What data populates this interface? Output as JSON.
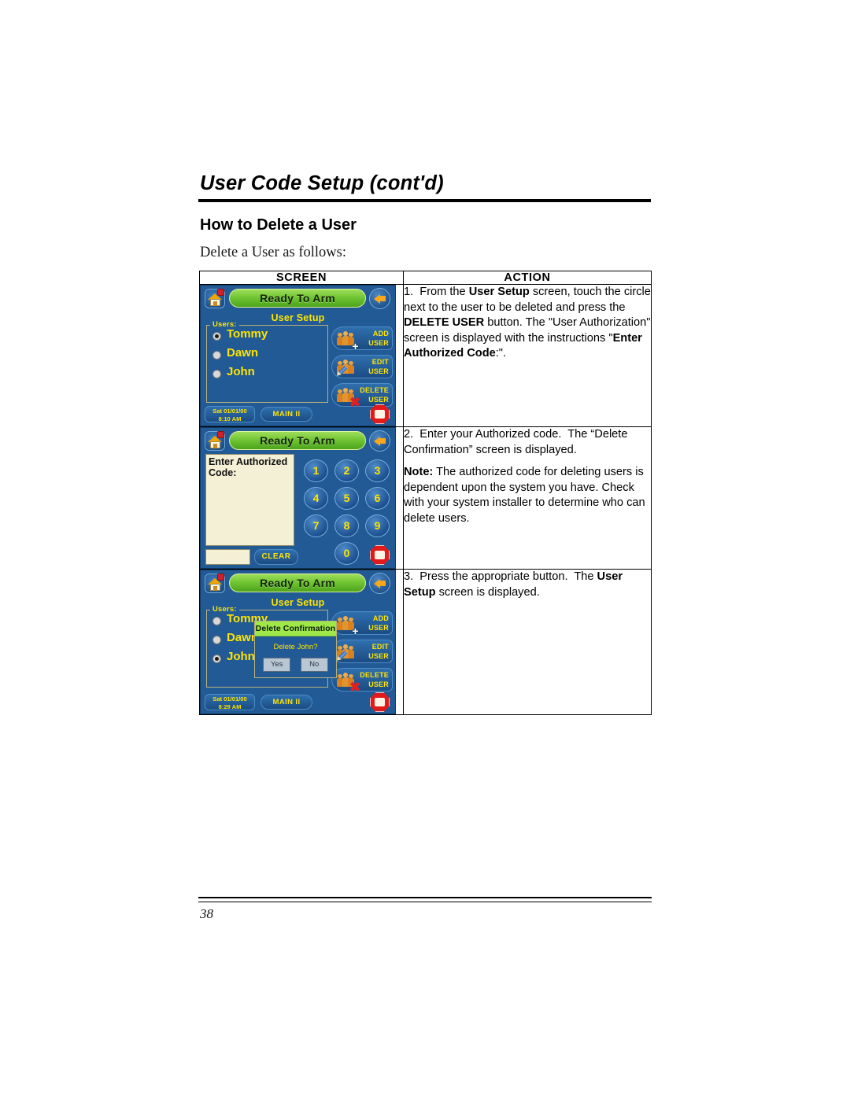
{
  "document": {
    "chapter_title": "User Code Setup (cont'd)",
    "section_heading": "How to Delete a User",
    "intro": "Delete a User as follows:",
    "page_number": "38"
  },
  "table": {
    "headers": {
      "screen": "SCREEN",
      "action": "ACTION"
    },
    "rows": [
      {
        "action_paragraphs": [
          "1.  From the User Setup screen, touch the circle next to the user to be deleted and press the DELETE USER button. The \"User Authorization\" screen is displayed with the instructions \"Enter Authorized Code:\"."
        ]
      },
      {
        "action_paragraphs": [
          "2.  Enter your Authorized code.  The “Delete Confirmation” screen is displayed.",
          "Note: The authorized code for deleting users is dependent upon the system you have. Check with your system installer to determine who can delete users."
        ]
      },
      {
        "action_paragraphs": [
          "3.  Press the appropriate button.  The User Setup screen is displayed."
        ]
      }
    ]
  },
  "panel1": {
    "status": "Ready To Arm",
    "screen_title": "User Setup",
    "users_legend": "Users:",
    "users": [
      {
        "name": "Tommy",
        "selected": true
      },
      {
        "name": "Dawn",
        "selected": false
      },
      {
        "name": "John",
        "selected": false
      }
    ],
    "side_buttons": [
      {
        "line1": "ADD",
        "line2": "USER"
      },
      {
        "line1": "EDIT",
        "line2": "USER"
      },
      {
        "line1": "DELETE",
        "line2": "USER"
      }
    ],
    "date": "Sat 01/01/00",
    "time": "8:10 AM",
    "main_button": "MAIN II"
  },
  "panel2": {
    "status": "Ready To Arm",
    "prompt": "Enter Authorized Code:",
    "entry_value": "",
    "clear_button": "CLEAR",
    "keys": [
      "1",
      "2",
      "3",
      "4",
      "5",
      "6",
      "7",
      "8",
      "9",
      "0"
    ]
  },
  "panel3": {
    "status": "Ready To Arm",
    "screen_title": "User Setup",
    "users_legend": "Users:",
    "users": [
      {
        "name": "Tommy",
        "selected": false
      },
      {
        "name": "Dawn",
        "selected": false
      },
      {
        "name": "John",
        "selected": true
      }
    ],
    "side_buttons": [
      {
        "line1": "ADD",
        "line2": "USER"
      },
      {
        "line1": "EDIT",
        "line2": "USER"
      },
      {
        "line1": "DELETE",
        "line2": "USER"
      }
    ],
    "dialog": {
      "title": "Delete Confirmation",
      "message": "Delete John?",
      "yes": "Yes",
      "no": "No"
    },
    "date": "Sat 01/01/00",
    "time": "8:29 AM",
    "main_button": "MAIN II"
  },
  "colors": {
    "screen_blue": "#215a95",
    "status_green": "#6cc230",
    "label_yellow": "#ffe400",
    "panic_red": "#e01b1b",
    "field_cream": "#f4f0d6"
  }
}
